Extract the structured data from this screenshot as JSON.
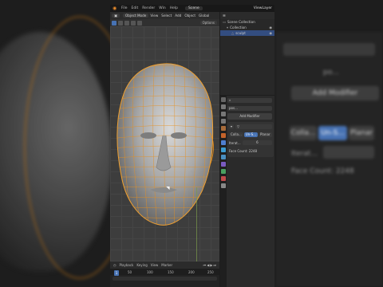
{
  "top_menu": {
    "items": [
      "File",
      "Edit",
      "Render",
      "Win",
      "Help"
    ],
    "workspace": "Scene",
    "view_layer": "ViewLayer"
  },
  "viewport": {
    "mode": "Object Mode",
    "menus": [
      "View",
      "Select",
      "Add",
      "Object"
    ],
    "global": "Global",
    "options": "Options"
  },
  "outliner": {
    "header": "Scene Collection",
    "collection": "Collection",
    "object": "sculpt"
  },
  "properties": {
    "object_name": "pos...",
    "add_modifier": "Add Modifier",
    "modifier_tabs": [
      "Colla...",
      "Un-S...",
      "Planar"
    ],
    "iterations_label": "Iterat...",
    "iterations_value": "6",
    "face_count_label": "Face Count: 2248"
  },
  "timeline": {
    "menus": [
      "Playback",
      "Keying",
      "View",
      "Marker"
    ],
    "ticks": [
      "0",
      "50",
      "100",
      "150",
      "200",
      "250"
    ],
    "current_frame": "1"
  },
  "background_panel": {
    "object_name": "po...",
    "add_modifier": "Add Modifier",
    "modifier_tabs": [
      "Colla...",
      "Un-S...",
      "Planar"
    ],
    "iterations_label": "Iterat...",
    "face_count_label": "Face Count: 2248"
  },
  "colors": {
    "wire_orange": "#e8901e",
    "accent_blue": "#4772b3",
    "viewport_bg": "#3d3d3d"
  }
}
